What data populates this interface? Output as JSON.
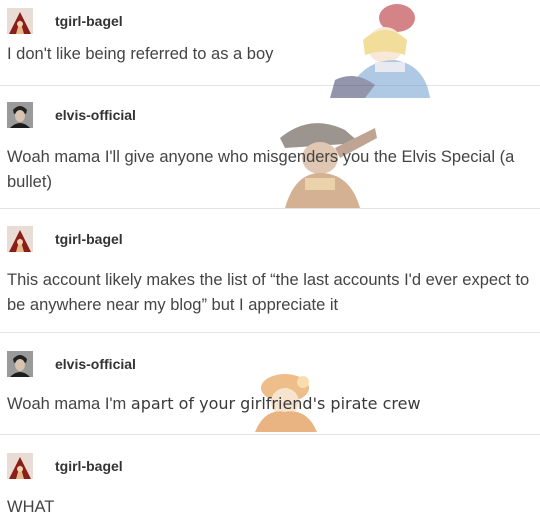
{
  "posts": [
    {
      "username": "tgirl-bagel",
      "avatar": "tgirl-bagel-avatar",
      "text": "I don't like being referred to as a boy"
    },
    {
      "username": "elvis-official",
      "avatar": "elvis-official-avatar",
      "text": "Woah mama I'll give anyone who misgenders you the Elvis Special (a bullet)"
    },
    {
      "username": "tgirl-bagel",
      "avatar": "tgirl-bagel-avatar",
      "text": "This account likely makes the list of “the last accounts I'd ever expect to be anywhere near my blog” but I appreciate it"
    },
    {
      "username": "elvis-official",
      "avatar": "elvis-official-avatar",
      "text_a": "Woah mama I'm ",
      "text_b": "apart of your girlfriend's pirate crew"
    },
    {
      "username": "tgirl-bagel",
      "avatar": "tgirl-bagel-avatar",
      "text": "WHAT"
    }
  ]
}
